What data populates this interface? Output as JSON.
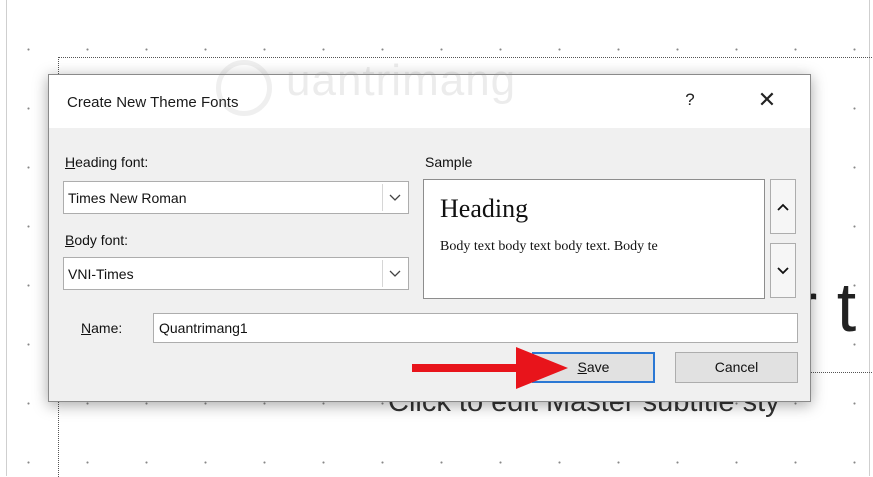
{
  "background": {
    "title_tail": "r t",
    "subtitle": "Click to edit Master subtitle sty"
  },
  "watermark": {
    "text": "uantrimang"
  },
  "dialog": {
    "title": "Create New Theme Fonts",
    "help_label": "?",
    "close_label": "✕",
    "heading_font": {
      "label_accel": "H",
      "label_rest": "eading font:",
      "value": "Times New Roman"
    },
    "body_font": {
      "label_accel": "B",
      "label_rest": "ody font:",
      "value": "VNI-Times"
    },
    "sample": {
      "label": "Sample",
      "heading": "Heading",
      "body": "Body text body text body text. Body te"
    },
    "name": {
      "label_accel": "N",
      "label_rest": "ame:",
      "value": "Quantrimang1"
    },
    "save": {
      "label_accel": "S",
      "label_rest": "ave"
    },
    "cancel": {
      "label": "Cancel"
    }
  },
  "colors": {
    "focus_border": "#2b78d4",
    "annotation_arrow": "#e8141b",
    "dialog_bg": "#f0f0f0"
  },
  "icons": [
    "chevron-down-icon",
    "chevron-up-icon",
    "close-icon",
    "help-icon",
    "red-arrow-icon"
  ]
}
